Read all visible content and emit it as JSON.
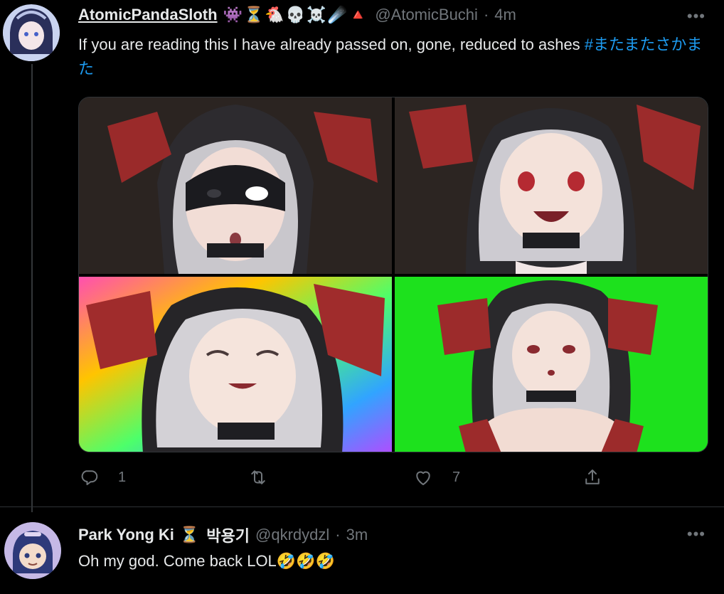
{
  "tweets": [
    {
      "author_name": "AtomicPandaSloth",
      "author_emojis": "👾⏳🐔💀☠️☄️🔺",
      "handle": "@AtomicBuchi",
      "separator": "·",
      "time": "4m",
      "text": "If you are reading this I have already passed on, gone, reduced to ashes ",
      "hashtag": "#またまたさかまた",
      "media_count": 4,
      "reply_count": "1",
      "retweet_count": "",
      "like_count": "7"
    },
    {
      "author_name": "Park Yong Ki",
      "author_emojis": "⏳",
      "author_name_extra": "박용기",
      "handle": "@qkrdydzl",
      "separator": "·",
      "time": "3m",
      "text": "Oh my god. Come back LOL",
      "text_emojis": "🤣🤣🤣"
    }
  ],
  "icons": {
    "more": "more-icon",
    "reply": "reply-icon",
    "retweet": "retweet-icon",
    "like": "like-icon",
    "share": "share-icon"
  },
  "colors": {
    "background": "#000000",
    "text": "#e7e9ea",
    "secondary": "#71767b",
    "link": "#1d9bf0",
    "greenscreen": "#1de11d"
  }
}
